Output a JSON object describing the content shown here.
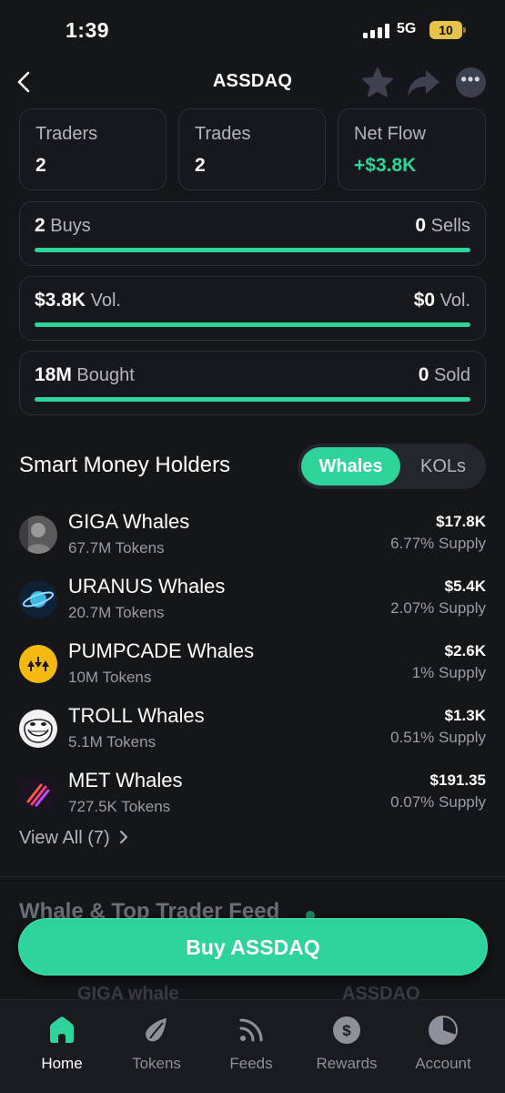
{
  "status": {
    "time": "1:39",
    "network": "5G",
    "battery": "10"
  },
  "header": {
    "title": "ASSDAQ"
  },
  "stats": {
    "traders": {
      "label": "Traders",
      "value": "2"
    },
    "trades": {
      "label": "Trades",
      "value": "2"
    },
    "net_flow": {
      "label": "Net Flow",
      "value": "+$3.8K"
    }
  },
  "bars": [
    {
      "left_value": "2",
      "left_label": "Buys",
      "right_value": "0",
      "right_label": "Sells",
      "fill_fraction": 1.0
    },
    {
      "left_value": "$3.8K",
      "left_label": "Vol.",
      "right_value": "$0",
      "right_label": "Vol.",
      "fill_fraction": 1.0
    },
    {
      "left_value": "18M",
      "left_label": "Bought",
      "right_value": "0",
      "right_label": "Sold",
      "fill_fraction": 1.0
    }
  ],
  "holders_section": {
    "title": "Smart Money Holders",
    "toggle": {
      "selected": "Whales",
      "other": "KOLs"
    },
    "items": [
      {
        "name": "GIGA Whales",
        "tokens": "67.7M Tokens",
        "value": "$17.8K",
        "supply": "6.77% Supply",
        "avatar": "giga-avatar"
      },
      {
        "name": "URANUS Whales",
        "tokens": "20.7M Tokens",
        "value": "$5.4K",
        "supply": "2.07% Supply",
        "avatar": "uranus-avatar"
      },
      {
        "name": "PUMPCADE Whales",
        "tokens": "10M Tokens",
        "value": "$2.6K",
        "supply": "1% Supply",
        "avatar": "pumpcade-avatar"
      },
      {
        "name": "TROLL Whales",
        "tokens": "5.1M Tokens",
        "value": "$1.3K",
        "supply": "0.51% Supply",
        "avatar": "troll-avatar"
      },
      {
        "name": "MET Whales",
        "tokens": "727.5K Tokens",
        "value": "$191.35",
        "supply": "0.07% Supply",
        "avatar": "met-avatar"
      }
    ],
    "view_all": "View All (7)"
  },
  "feed": {
    "title": "Whale & Top Trader Feed",
    "row_left": "GIGA whale",
    "row_right": "ASSDAQ"
  },
  "buy_button": "Buy ASSDAQ",
  "tabs": [
    {
      "label": "Home",
      "icon": "home-icon",
      "active": true
    },
    {
      "label": "Tokens",
      "icon": "tokens-icon",
      "active": false
    },
    {
      "label": "Feeds",
      "icon": "feeds-icon",
      "active": false
    },
    {
      "label": "Rewards",
      "icon": "rewards-icon",
      "active": false
    },
    {
      "label": "Account",
      "icon": "account-icon",
      "active": false
    }
  ],
  "colors": {
    "accent": "#2fd49b",
    "background": "#15161a",
    "card_border": "#2d2f38"
  }
}
